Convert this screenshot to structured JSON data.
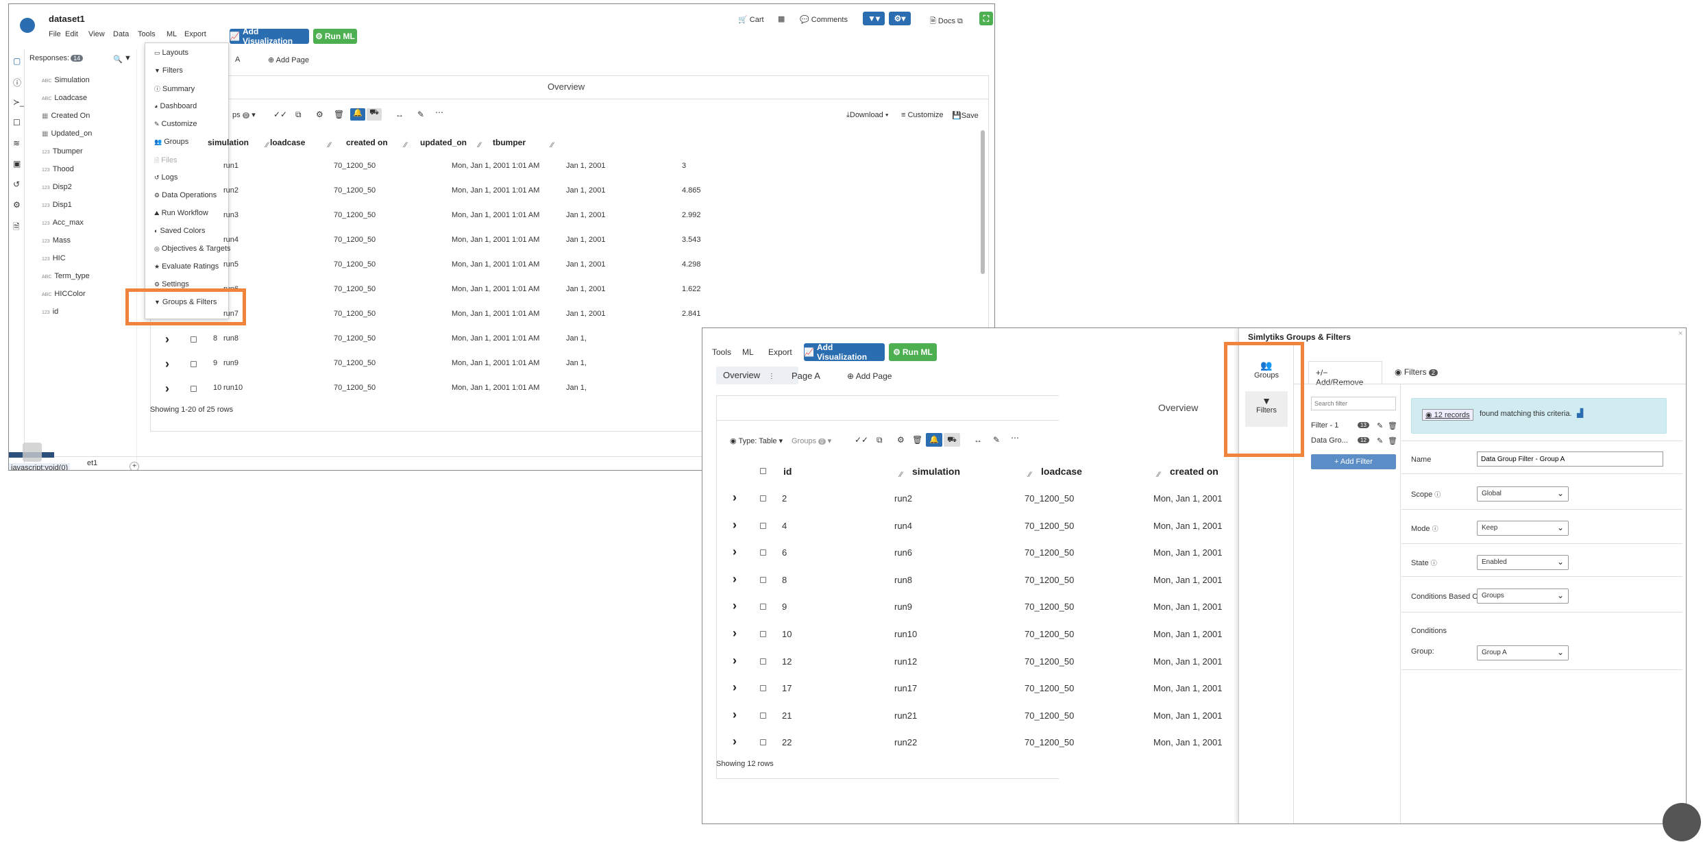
{
  "app": {
    "title": "dataset1",
    "menu": [
      "File",
      "Edit",
      "View",
      "Data",
      "Tools",
      "ML",
      "Export"
    ],
    "add_visualization": "Add Visualization",
    "run_ml": "Run ML",
    "cart": "Cart",
    "comments": "Comments",
    "docs": "Docs",
    "responses_label": "Responses:",
    "responses_count": "14",
    "bottom_status": "javascript:void(0)",
    "bottom_tab_fragment": "et1"
  },
  "responses": [
    {
      "type": "ABC",
      "name": "Simulation"
    },
    {
      "type": "ABC",
      "name": "Loadcase"
    },
    {
      "type": "",
      "name": "Created On"
    },
    {
      "type": "",
      "name": "Updated_on"
    },
    {
      "type": "123",
      "name": "Tbumper"
    },
    {
      "type": "123",
      "name": "Thood"
    },
    {
      "type": "123",
      "name": "Disp2"
    },
    {
      "type": "123",
      "name": "Disp1"
    },
    {
      "type": "123",
      "name": "Acc_max"
    },
    {
      "type": "123",
      "name": "Mass"
    },
    {
      "type": "123",
      "name": "HIC"
    },
    {
      "type": "ABC",
      "name": "Term_type"
    },
    {
      "type": "ABC",
      "name": "HICColor"
    },
    {
      "type": "123",
      "name": "id"
    }
  ],
  "tools_menu": [
    "Layouts",
    "Filters",
    "Summary",
    "Dashboard",
    "Customize",
    "Groups",
    "Files",
    "Logs",
    "Data Operations",
    "Run Workflow",
    "Saved Colors",
    "Objectives & Targets",
    "Evaluate Ratings",
    "Settings",
    "Groups & Filters"
  ],
  "page_tabs": {
    "tab_a_fragment": "A",
    "add_page": "Add Page"
  },
  "main_table": {
    "title": "Overview",
    "groups_fragment": "ps",
    "groups_count": "0",
    "download": "Download",
    "customize": "Customize",
    "save": "Save",
    "columns": [
      "simulation",
      "loadcase",
      "created on",
      "updated_on",
      "tbumper"
    ],
    "rows": [
      [
        "",
        "run1",
        "70_1200_50",
        "Mon, Jan 1, 2001 1:01 AM",
        "Jan 1, 2001",
        "3"
      ],
      [
        "",
        "run2",
        "70_1200_50",
        "Mon, Jan 1, 2001 1:01 AM",
        "Jan 1, 2001",
        "4.865"
      ],
      [
        "",
        "run3",
        "70_1200_50",
        "Mon, Jan 1, 2001 1:01 AM",
        "Jan 1, 2001",
        "2.992"
      ],
      [
        "",
        "run4",
        "70_1200_50",
        "Mon, Jan 1, 2001 1:01 AM",
        "Jan 1, 2001",
        "3.543"
      ],
      [
        "",
        "run5",
        "70_1200_50",
        "Mon, Jan 1, 2001 1:01 AM",
        "Jan 1, 2001",
        "4.298"
      ],
      [
        "",
        "run6",
        "70_1200_50",
        "Mon, Jan 1, 2001 1:01 AM",
        "Jan 1, 2001",
        "1.622"
      ],
      [
        "",
        "run7",
        "70_1200_50",
        "Mon, Jan 1, 2001 1:01 AM",
        "Jan 1, 2001",
        "2.841"
      ],
      [
        "8",
        "run8",
        "70_1200_50",
        "Mon, Jan 1, 2001 1:01 AM",
        "Jan 1,",
        ""
      ],
      [
        "9",
        "run9",
        "70_1200_50",
        "Mon, Jan 1, 2001 1:01 AM",
        "Jan 1,",
        ""
      ],
      [
        "10",
        "run10",
        "70_1200_50",
        "Mon, Jan 1, 2001 1:01 AM",
        "Jan 1,",
        ""
      ]
    ],
    "footer": "Showing 1-20 of 25 rows"
  },
  "zoom": {
    "menu": [
      "Tools",
      "ML",
      "Export"
    ],
    "add_visualization": "Add Visualization",
    "run_ml": "Run ML",
    "tab_overview": "Overview",
    "tab_page_a": "Page A",
    "add_page": "Add Page",
    "table_title": "Overview",
    "type_label": "Type: Table",
    "groups_label": "Groups",
    "groups_count": "0",
    "columns": [
      "id",
      "simulation",
      "loadcase",
      "created on"
    ],
    "rows": [
      [
        "2",
        "run2",
        "70_1200_50",
        "Mon, Jan 1, 2001"
      ],
      [
        "4",
        "run4",
        "70_1200_50",
        "Mon, Jan 1, 2001"
      ],
      [
        "6",
        "run6",
        "70_1200_50",
        "Mon, Jan 1, 2001"
      ],
      [
        "8",
        "run8",
        "70_1200_50",
        "Mon, Jan 1, 2001"
      ],
      [
        "9",
        "run9",
        "70_1200_50",
        "Mon, Jan 1, 2001"
      ],
      [
        "10",
        "run10",
        "70_1200_50",
        "Mon, Jan 1, 2001"
      ],
      [
        "12",
        "run12",
        "70_1200_50",
        "Mon, Jan 1, 2001"
      ],
      [
        "17",
        "run17",
        "70_1200_50",
        "Mon, Jan 1, 2001"
      ],
      [
        "21",
        "run21",
        "70_1200_50",
        "Mon, Jan 1, 2001"
      ],
      [
        "22",
        "run22",
        "70_1200_50",
        "Mon, Jan 1, 2001"
      ]
    ],
    "footer": "Showing 12 rows"
  },
  "panel": {
    "title": "Simlytiks Groups & Filters",
    "side_groups": "Groups",
    "side_filters": "Filters",
    "tab_add_remove": "+/− Add/Remove",
    "tab_filters": "Filters",
    "tab_filters_count": "2",
    "search_placeholder": "Search filter",
    "filter_items": [
      {
        "name": "Filter - 1",
        "count": "13"
      },
      {
        "name": "Data Gro...",
        "count": "12"
      }
    ],
    "add_filter": "+ Add Filter",
    "records_link": "12 records",
    "records_text": "found matching this criteria.",
    "name_label": "Name",
    "name_value": "Data Group Filter - Group A",
    "scope_label": "Scope",
    "scope_value": "Global",
    "mode_label": "Mode",
    "mode_value": "Keep",
    "state_label": "State",
    "state_value": "Enabled",
    "cond_based_label": "Conditions Based C",
    "cond_based_value": "Groups",
    "conditions_label": "Conditions",
    "group_label": "Group:",
    "group_value": "Group A"
  },
  "colors": {
    "accent_blue": "#2a6db0",
    "run_green": "#4caf50",
    "highlight_orange": "#f0843c"
  }
}
